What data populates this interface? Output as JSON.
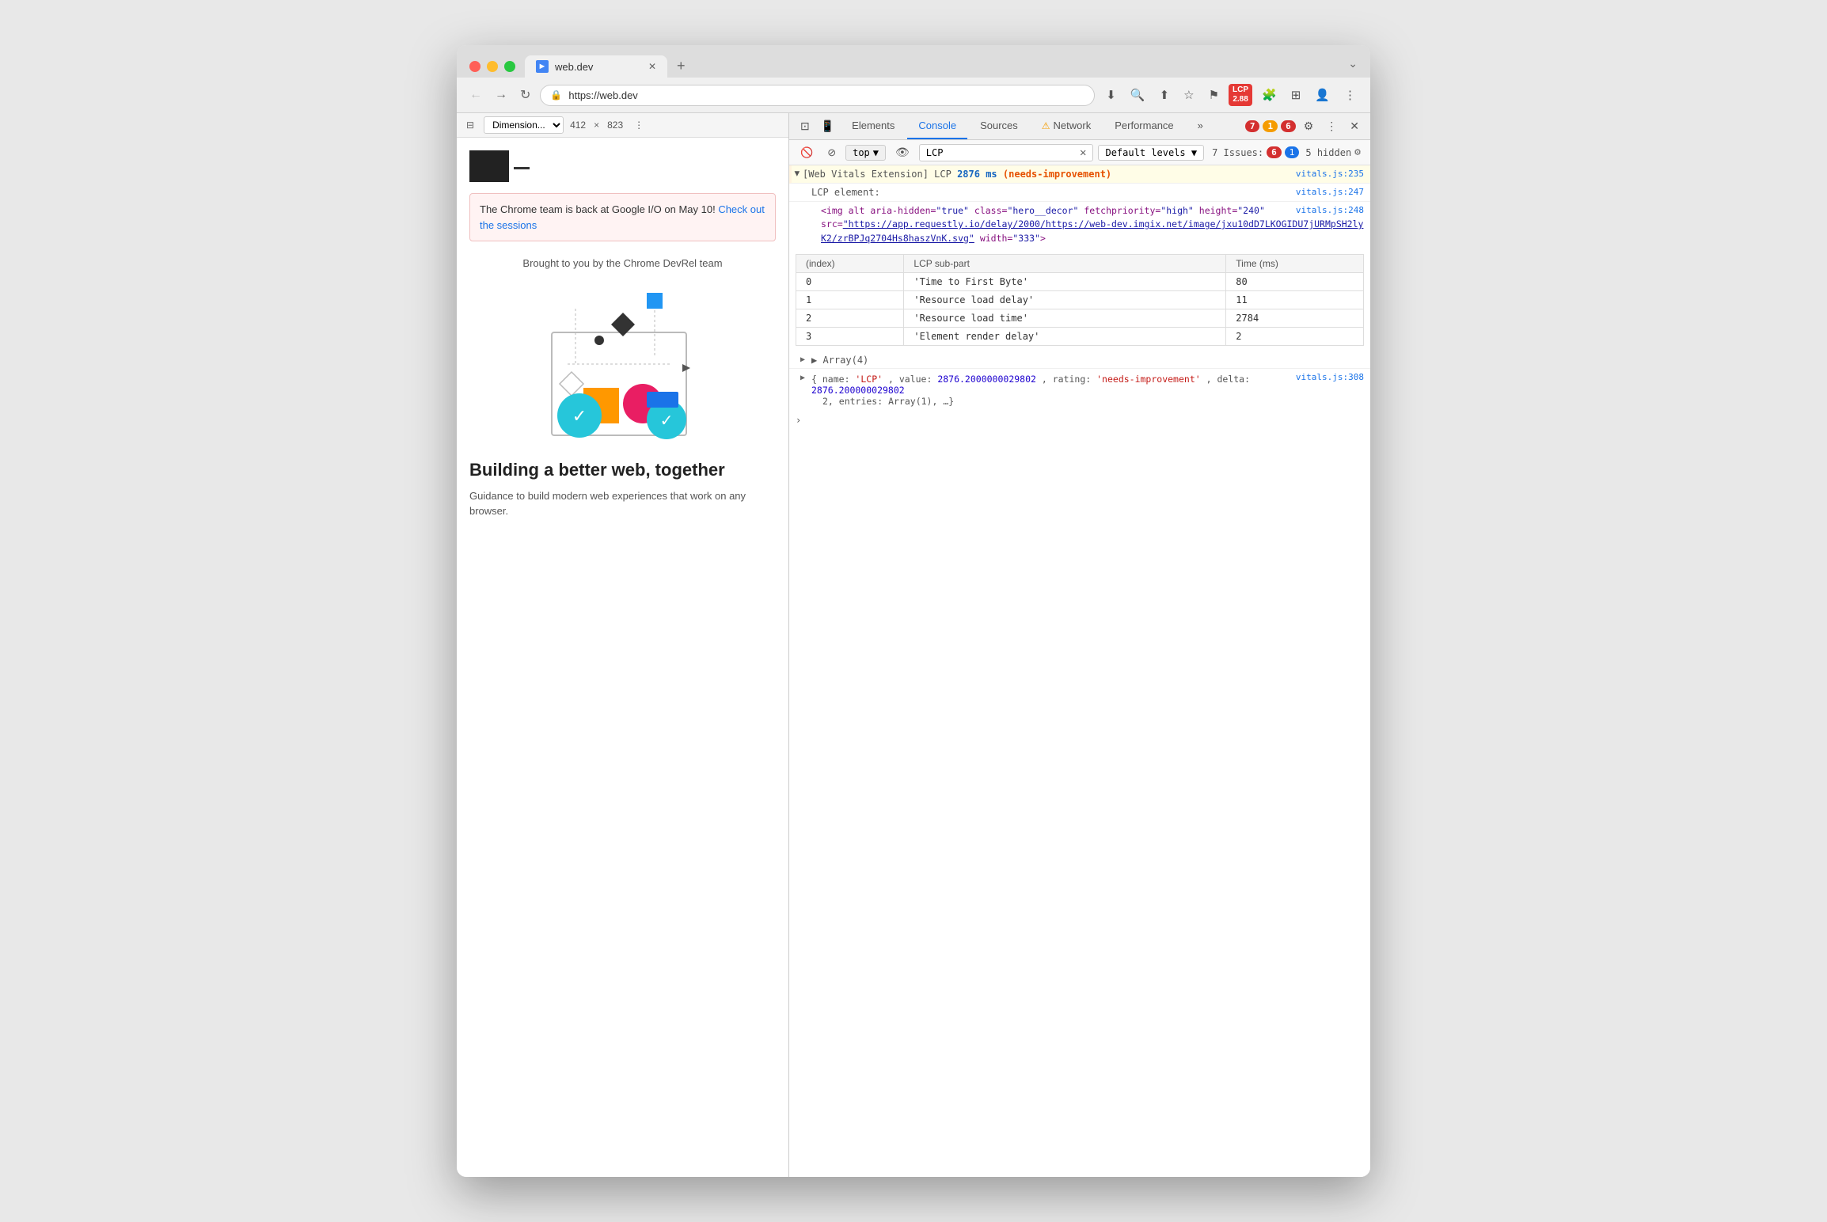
{
  "browser": {
    "tab_title": "web.dev",
    "tab_favicon": "►",
    "url": "https://web.dev",
    "new_tab_label": "+",
    "chevron": "⌄",
    "dimension_label": "Dimension...",
    "width": "412",
    "height": "823"
  },
  "toolbar": {
    "back": "←",
    "forward": "→",
    "reload": "↻",
    "download": "⬇",
    "search": "🔍",
    "share": "⬆",
    "bookmark": "☆",
    "flag": "⚑",
    "lcp_label": "LCP",
    "lcp_value": "2.88",
    "extensions": "🧩",
    "split": "⊞",
    "profile": "👤",
    "more": "⋮"
  },
  "viewport": {
    "notification": {
      "text": "The Chrome team is back at Google I/O on May 10! ",
      "link_text": "Check out the sessions"
    },
    "brought_by": "Brought to you by the Chrome DevRel team",
    "heading": "Building a better web, together",
    "subtext": "Guidance to build modern web experiences that work on any browser."
  },
  "devtools": {
    "tabs": {
      "elements": "Elements",
      "console": "Console",
      "sources": "Sources",
      "network": "Network",
      "performance": "Performance",
      "more": "»"
    },
    "errors_count": "7",
    "warnings_count": "1",
    "error_badge2": "6",
    "console": {
      "context": "top",
      "filter_value": "LCP",
      "levels": "Default levels",
      "issues_label": "7 Issues:",
      "issues_errors": "6",
      "issues_messages": "1",
      "hidden": "5 hidden",
      "lcp_header": "[Web Vitals Extension] LCP",
      "lcp_ms": "2876 ms",
      "lcp_status": "(needs-improvement)",
      "ref1": "vitals.js:235",
      "lcp_element_label": "LCP element:",
      "ref2": "vitals.js:247",
      "img_attrs": "<img alt aria-hidden=\"true\" class=\"hero__decor\" fetchpriority=\"high\" height=\"240\" src=\"",
      "img_src_link": "https://app.requestly.io/delay/2000/https://web-dev.imgix.net/image/jxu10dD7LKOGIDU7jURMpSH2lyK2/zrBPJq2704Hs8haszVnK.svg",
      "img_end": "\" width=\"333\">",
      "ref3": "vitals.js:248",
      "table_headers": [
        "(index)",
        "LCP sub-part",
        "Time (ms)"
      ],
      "table_rows": [
        {
          "index": "0",
          "part": "'Time to First Byte'",
          "time": "80"
        },
        {
          "index": "1",
          "part": "'Resource load delay'",
          "time": "11"
        },
        {
          "index": "2",
          "part": "'Resource load time'",
          "time": "2784"
        },
        {
          "index": "3",
          "part": "'Element render delay'",
          "time": "2"
        }
      ],
      "array_label": "▶ Array(4)",
      "ref4": "vitals.js:308",
      "obj_line": "{name: 'LCP', value: 2876.2000000029802, rating: 'needs-improvement', delta: 2876.200000029802, entries: Array(1), …}",
      "obj_name_key": "name",
      "obj_name_val": "'LCP'",
      "obj_value_key": "value",
      "obj_value_val": "2876.2000000029802",
      "obj_rating_key": "rating",
      "obj_rating_val": "'needs-improvement'",
      "obj_delta_key": "delta",
      "obj_delta_val": "2876.200000029802"
    }
  }
}
